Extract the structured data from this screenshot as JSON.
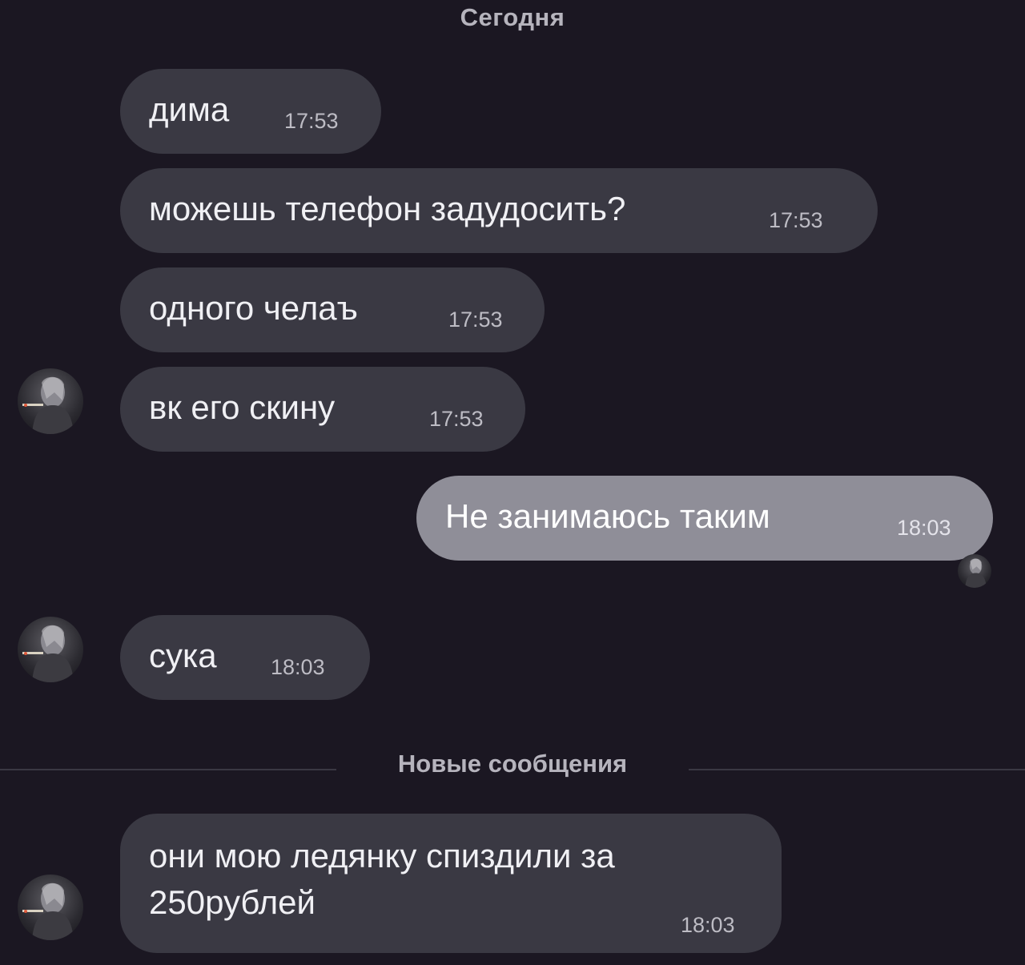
{
  "date_label": "Сегодня",
  "divider_label": "Новые сообщения",
  "messages": [
    {
      "text": "дима",
      "time": "17:53",
      "direction": "incoming"
    },
    {
      "text": "можешь телефон задудосить?",
      "time": "17:53",
      "direction": "incoming"
    },
    {
      "text": "одного челаъ",
      "time": "17:53",
      "direction": "incoming"
    },
    {
      "text": "вк его скину",
      "time": "17:53",
      "direction": "incoming"
    },
    {
      "text": "Не занимаюсь таким",
      "time": "18:03",
      "direction": "outgoing"
    },
    {
      "text": "сука",
      "time": "18:03",
      "direction": "incoming"
    },
    {
      "text": "они мою ледянку спиздили за 250рублей",
      "time": "18:03",
      "direction": "incoming"
    }
  ],
  "colors": {
    "background": "#1b1722",
    "incoming_bubble": "#3a3943",
    "outgoing_bubble": "#8f8e98",
    "meta_text": "#b6b4bd"
  }
}
